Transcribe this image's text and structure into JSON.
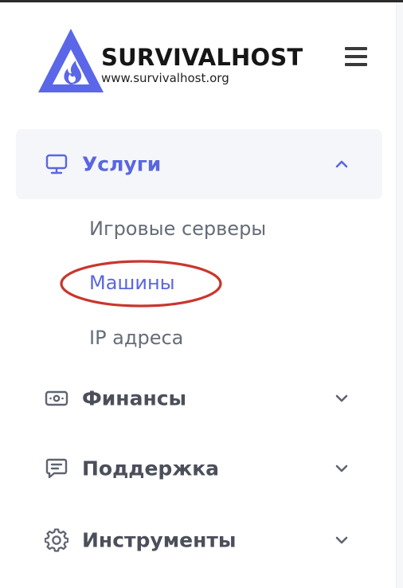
{
  "brand": {
    "name": "SURVIVALHOST",
    "url": "www.survivalhost.org",
    "logo_icon": "triangle-flame-logo"
  },
  "header": {
    "menu_icon": "hamburger-icon"
  },
  "colors": {
    "accent": "#5a66e0",
    "logo_blue": "#5b67e8",
    "muted_text": "#666d78",
    "nav_text": "#4b4f5a",
    "active_bg": "#f4f6fa",
    "annotation_red": "#c8372d"
  },
  "nav": {
    "services": {
      "label": "Услуги",
      "icon": "monitor-icon",
      "expanded": true,
      "items": [
        {
          "label": "Игровые серверы"
        },
        {
          "label": "Машины",
          "current": true
        },
        {
          "label": "IP адреса"
        }
      ]
    },
    "finance": {
      "label": "Финансы",
      "icon": "cash-icon"
    },
    "support": {
      "label": "Поддержка",
      "icon": "chat-icon"
    },
    "tools": {
      "label": "Инструменты",
      "icon": "gear-icon"
    }
  }
}
